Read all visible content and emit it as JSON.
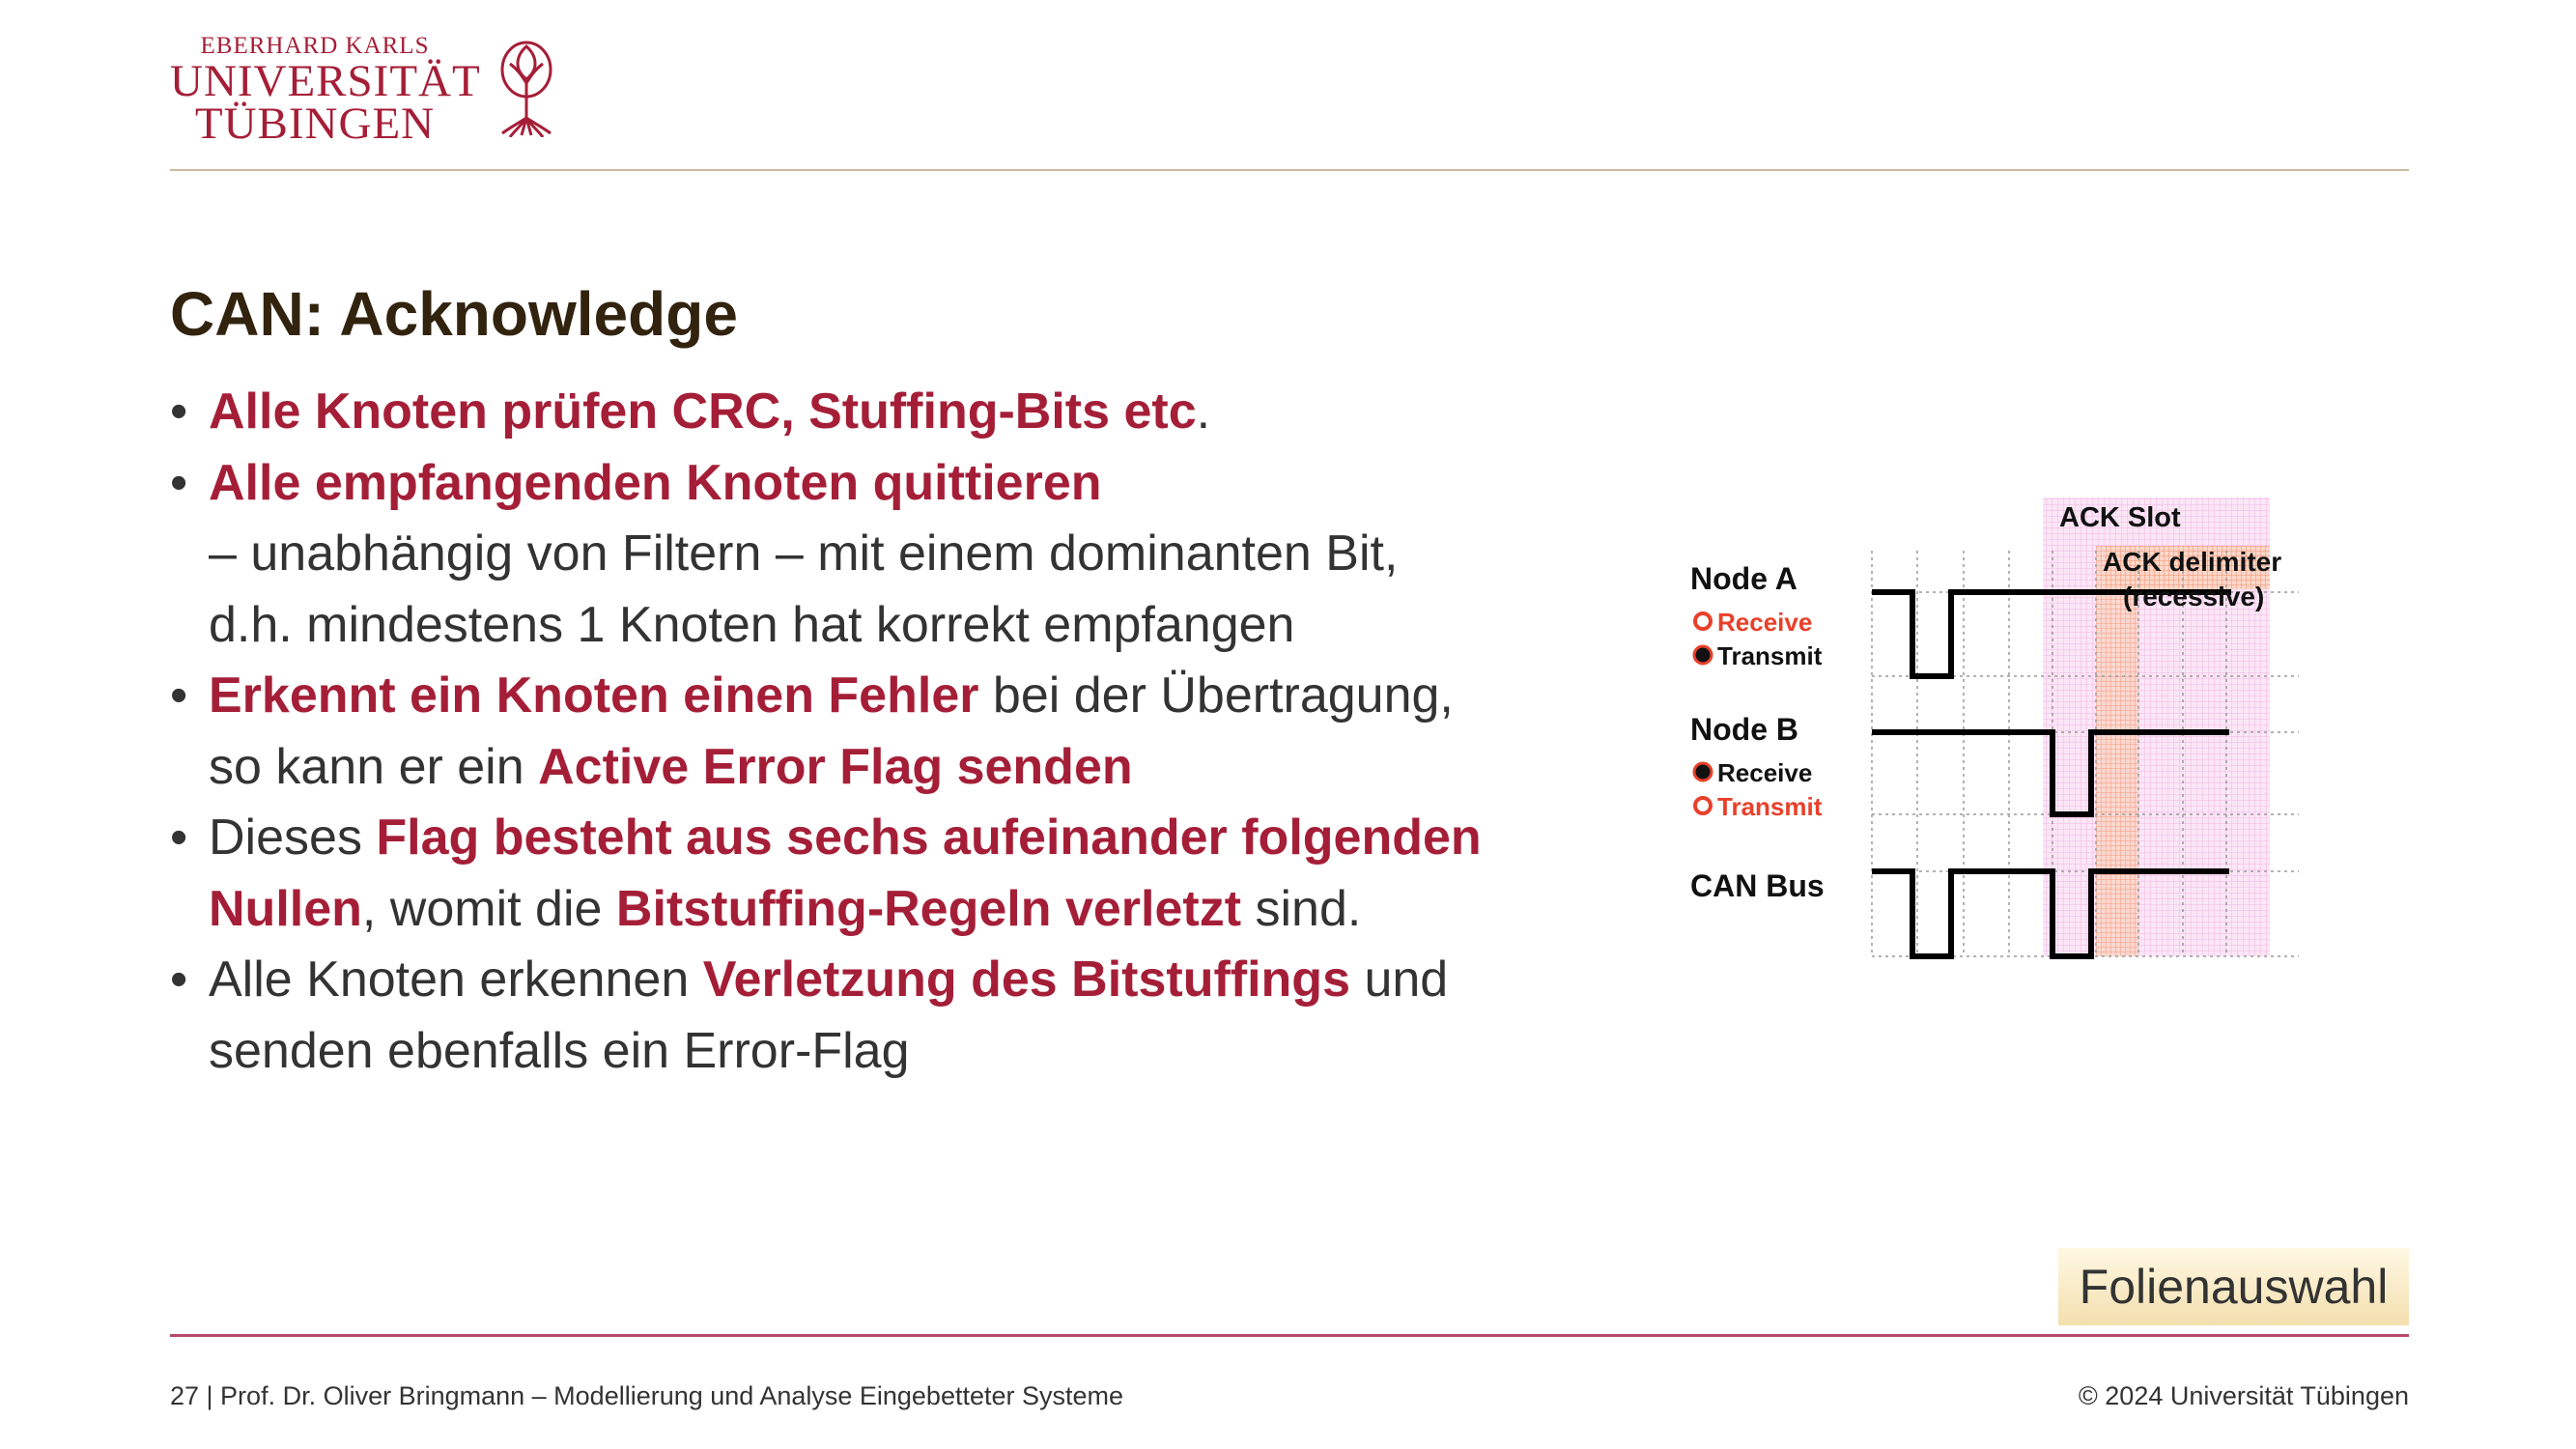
{
  "logo": {
    "line1": "EBERHARD KARLS",
    "line2": "UNIVERSITÄT",
    "line3": "TÜBINGEN",
    "icon": "tree-icon",
    "color": "#a51e37"
  },
  "title": "CAN: Acknowledge",
  "bullets": [
    {
      "hl": "Alle Knoten prüfen CRC, Stuffing-Bits etc",
      "rest": "."
    },
    {
      "hl": "Alle empfangenden Knoten quittieren",
      "line2": "– unabhängig von Filtern – mit einem dominanten Bit,",
      "line3": "d.h. mindestens 1 Knoten hat korrekt empfangen"
    },
    {
      "hl": "Erkennt ein Knoten einen Fehler",
      "t1": " bei der Übertragung,",
      "t2": "so kann er ein ",
      "hl2": "Active Error Flag senden"
    },
    {
      "t1": "Dieses ",
      "hl": "Flag besteht aus sechs aufeinander folgenden",
      "hl2": "Nullen",
      "t2": ", womit die ",
      "hl3": "Bitstuffing-Regeln verletzt",
      "t3": " sind."
    },
    {
      "t1": "Alle Knoten erkennen ",
      "hl": "Verletzung des Bitstuffings",
      "t2": " und",
      "t3": "senden ebenfalls ein Error-Flag"
    }
  ],
  "diagram": {
    "ack_slot": "ACK Slot",
    "ack_delimiter": "ACK delimiter",
    "recessive": "(recessive)",
    "node_a": "Node A",
    "node_b": "Node B",
    "can_bus": "CAN Bus",
    "receive": "Receive",
    "transmit": "Transmit",
    "accent": "#e8402a"
  },
  "button": {
    "label": "Folienauswahl"
  },
  "footer": {
    "left": "27 | Prof. Dr. Oliver Bringmann – Modellierung und Analyse Eingebetteter Systeme",
    "right": "© 2024 Universität Tübingen"
  }
}
